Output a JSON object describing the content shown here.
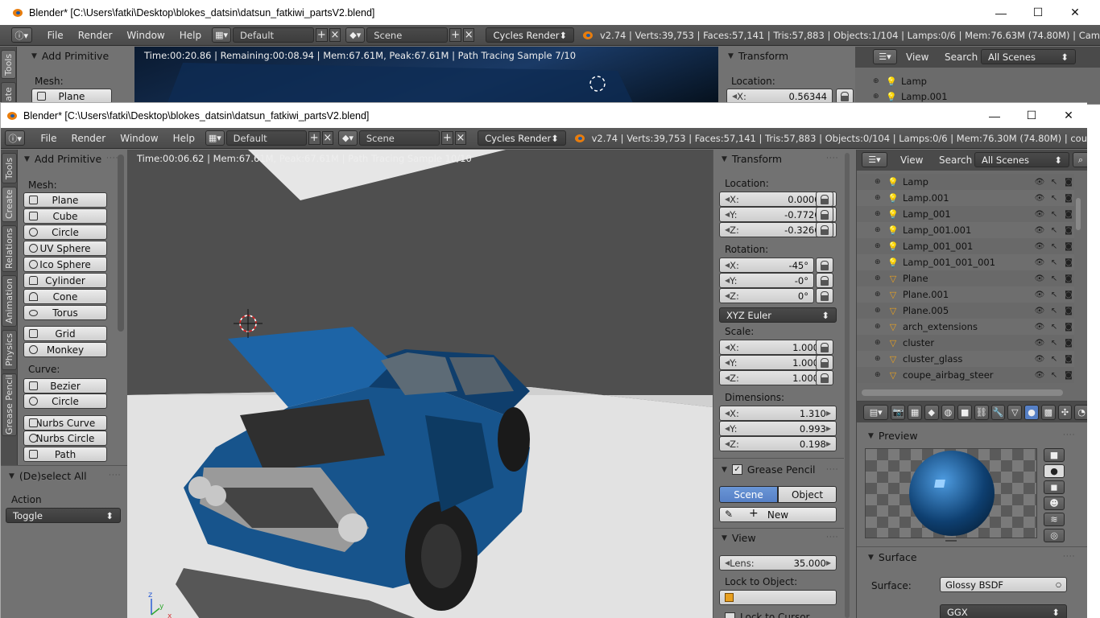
{
  "windows": {
    "back": {
      "title": "Blender* [C:\\Users\\fatki\\Desktop\\blokes_datsin\\datsun_fatkiwi_partsV2.blend]",
      "stats": "v2.74 | Verts:39,753 | Faces:57,141 | Tris:57,883 | Objects:1/104 | Lamps:0/6 | Mem:76.63M (74.80M) | Cam",
      "render_status": "Time:00:20.86 | Remaining:00:08.94 | Mem:67.61M, Peak:67.61M | Path Tracing Sample 7/10",
      "location_x": "0.56344",
      "outliner_rows": [
        "Lamp",
        "Lamp.001"
      ]
    },
    "front": {
      "title": "Blender* [C:\\Users\\fatki\\Desktop\\blokes_datsin\\datsun_fatkiwi_partsV2.blend]",
      "stats": "v2.74 | Verts:39,753 | Faces:57,141 | Tris:57,883 | Objects:0/104 | Lamps:0/6 | Mem:76.30M (74.80M) | cou",
      "render_status": "Time:00:06.62 | Mem:67.61M, Peak:67.61M | Path Tracing Sample 10/10"
    }
  },
  "window_controls": {
    "minimize": "—",
    "maximize": "☐",
    "close": "✕"
  },
  "menu": {
    "file": "File",
    "render": "Render",
    "window": "Window",
    "help": "Help"
  },
  "screen_layout": "Default",
  "scene": "Scene",
  "render_engine": "Cycles Render",
  "toolshelf": {
    "tabs": [
      "Tools",
      "Create",
      "Relations",
      "Animation",
      "Physics",
      "Grease Pencil"
    ],
    "back_tabs": [
      "Tools",
      "ate"
    ],
    "panel_title": "Add Primitive",
    "mesh_label": "Mesh:",
    "mesh_items": [
      "Plane",
      "Cube",
      "Circle",
      "UV Sphere",
      "Ico Sphere",
      "Cylinder",
      "Cone",
      "Torus"
    ],
    "more_mesh": [
      "Grid",
      "Monkey"
    ],
    "curve_label": "Curve:",
    "curve_items": [
      "Bezier",
      "Circle"
    ],
    "nurbs_items": [
      "Nurbs Curve",
      "Nurbs Circle",
      "Path"
    ]
  },
  "operator": {
    "title": "(De)select All",
    "action_label": "Action",
    "action_value": "Toggle"
  },
  "transform": {
    "title": "Transform",
    "location_label": "Location:",
    "location": {
      "x": "0.00000",
      "y": "-0.77267",
      "z": "-0.32669"
    },
    "rotation_label": "Rotation:",
    "rotation": {
      "x": "-45°",
      "y": "-0°",
      "z": "0°"
    },
    "rotation_mode": "XYZ Euler",
    "scale_label": "Scale:",
    "scale": {
      "x": "1.000",
      "y": "1.000",
      "z": "1.000"
    },
    "dimensions_label": "Dimensions:",
    "dimensions": {
      "x": "1.310",
      "y": "0.993",
      "z": "0.198"
    },
    "axis": {
      "x": "X:",
      "y": "Y:",
      "z": "Z:"
    }
  },
  "grease_pencil": {
    "title": "Grease Pencil",
    "scene": "Scene",
    "object": "Object",
    "new": "New"
  },
  "view_panel": {
    "title": "View",
    "lens_label": "Lens:",
    "lens": "35.000",
    "lock_object": "Lock to Object:",
    "lock_cursor": "Lock to Cursor"
  },
  "outliner": {
    "view": "View",
    "search": "Search",
    "filter": "All Scenes",
    "rows": [
      {
        "name": "Lamp",
        "type": "lamp"
      },
      {
        "name": "Lamp.001",
        "type": "lamp"
      },
      {
        "name": "Lamp_001",
        "type": "lamp"
      },
      {
        "name": "Lamp_001.001",
        "type": "lamp"
      },
      {
        "name": "Lamp_001_001",
        "type": "lamp"
      },
      {
        "name": "Lamp_001_001_001",
        "type": "lamp"
      },
      {
        "name": "Plane",
        "type": "mesh"
      },
      {
        "name": "Plane.001",
        "type": "mesh"
      },
      {
        "name": "Plane.005",
        "type": "mesh"
      },
      {
        "name": "arch_extensions",
        "type": "mesh"
      },
      {
        "name": "cluster",
        "type": "mesh"
      },
      {
        "name": "cluster_glass",
        "type": "mesh"
      },
      {
        "name": "coupe_airbag_steer",
        "type": "mesh"
      }
    ]
  },
  "material": {
    "preview_title": "Preview",
    "surface_title": "Surface",
    "surface_label": "Surface:",
    "surface_value": "Glossy BSDF",
    "distribution": "GGX"
  },
  "colors": {
    "accent": "#5680c6",
    "panel": "#727272",
    "header": "#4a4a4a",
    "car_blue": "#1c5d96"
  }
}
